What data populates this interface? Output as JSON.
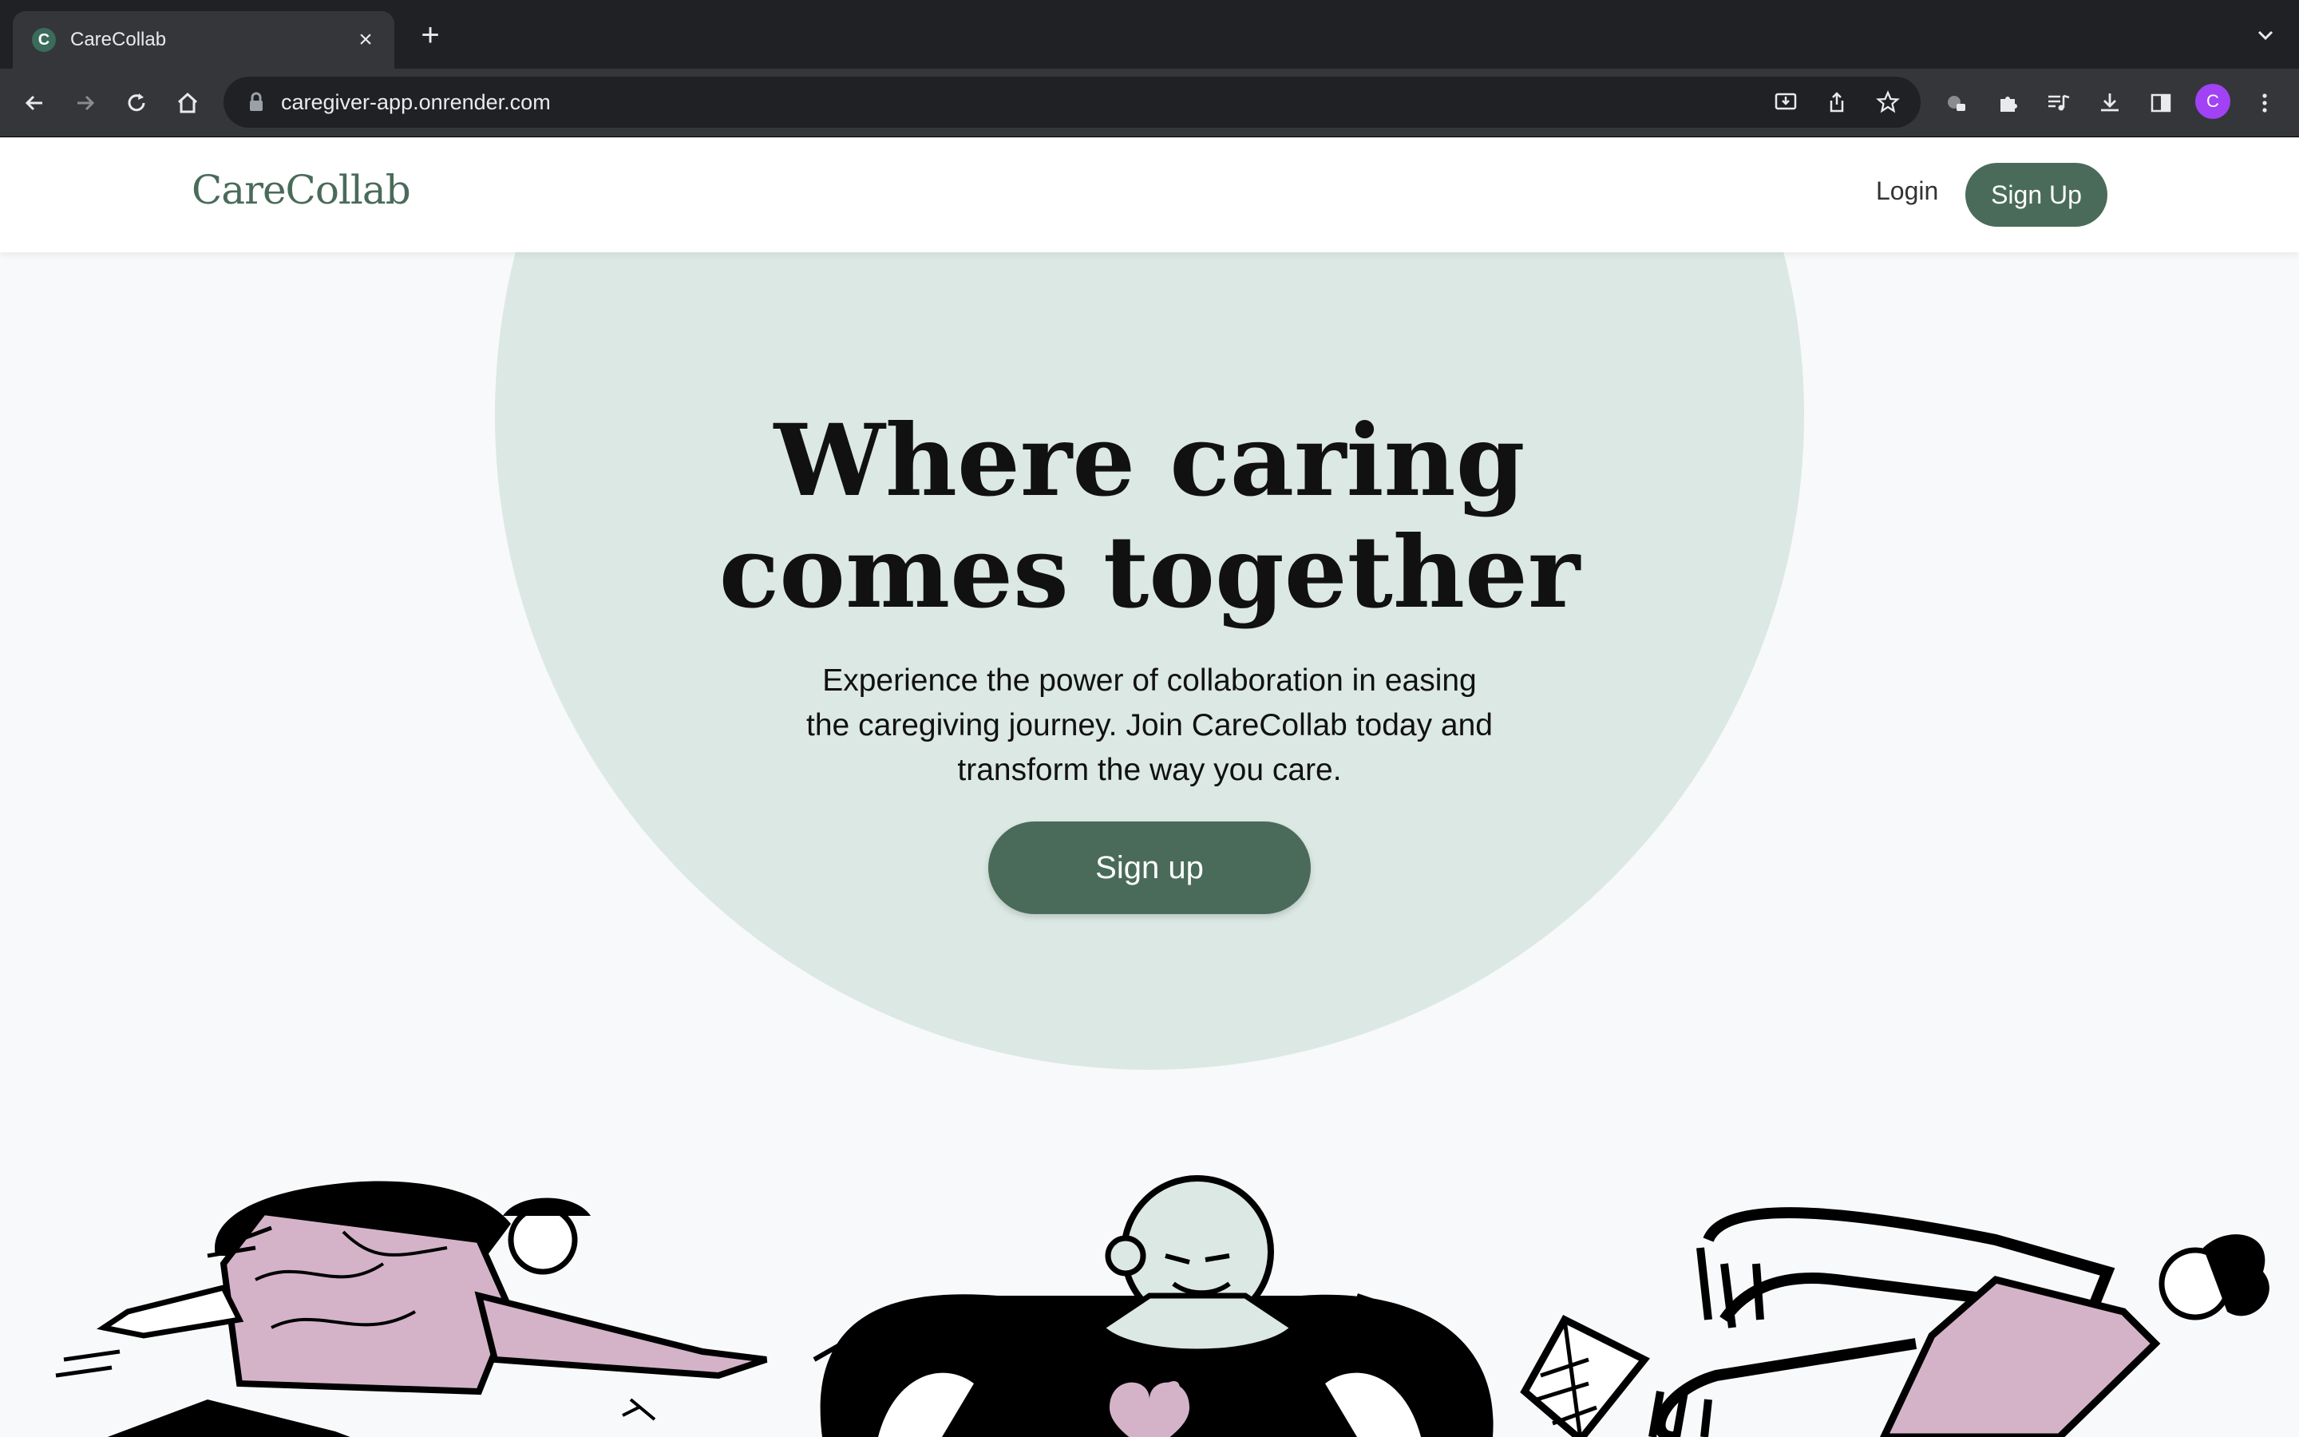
{
  "browser": {
    "tab_title": "CareCollab",
    "favicon_letter": "C",
    "url": "caregiver-app.onrender.com",
    "profile_initial": "C"
  },
  "header": {
    "logo": "CareCollab",
    "login_label": "Login",
    "signup_label": "Sign Up"
  },
  "hero": {
    "headline_line1": "Where caring",
    "headline_line2": "comes together",
    "subtext": "Experience the power of collaboration in easing the caregiving journey. Join CareCollab today and transform the way you care.",
    "cta_label": "Sign up"
  },
  "colors": {
    "brand": "#4a6b5a",
    "hero_circle": "#dbe8e4",
    "accent_pink": "#d4b3c9"
  }
}
